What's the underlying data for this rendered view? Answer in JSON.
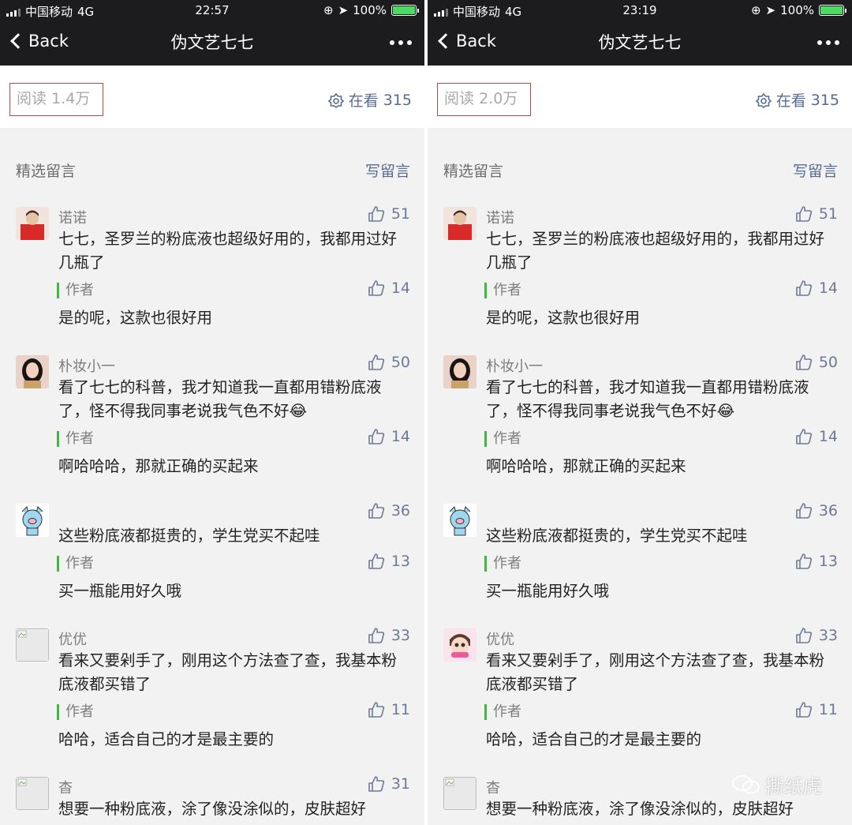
{
  "status_bar": {
    "carrier": "中国移动",
    "network": "4G",
    "battery": "100%"
  },
  "nav": {
    "back_label": "Back",
    "title": "伪文艺七七"
  },
  "section": {
    "title": "精选留言",
    "write_label": "写留言"
  },
  "stats_label_reads": "阅读",
  "stats_label_looking": "在看",
  "author_label": "作者",
  "panes": [
    {
      "time": "22:57",
      "reads": "1.4万",
      "looking": "315",
      "comments": [
        {
          "nickname": "诺诺",
          "likes": "51",
          "text": "七七，圣罗兰的粉底液也超级好用的，我都用过好几瓶了",
          "reply": "是的呢，这款也很好用",
          "reply_likes": "14",
          "avatar": "red-shirt"
        },
        {
          "nickname": "朴妆小一",
          "likes": "50",
          "text": "看了七七的科普，我才知道我一直都用错粉底液了，怪不得我同事老说我气色不好",
          "reply": "啊哈哈哈，那就正确的买起来",
          "reply_likes": "14",
          "avatar": "girl-photo"
        },
        {
          "nickname": "",
          "likes": "36",
          "text": "这些粉底液都挺贵的，学生党买不起哇",
          "reply": "买一瓶能用好久哦",
          "reply_likes": "13",
          "avatar": "pig-cartoon"
        },
        {
          "nickname": "优优",
          "likes": "33",
          "text": "看来又要剁手了，刚用这个方法查了查，我基本粉底液都买错了",
          "reply": "哈哈，适合自己的才是最主要的",
          "reply_likes": "11",
          "avatar": "broken-image"
        },
        {
          "nickname": "杳",
          "likes": "31",
          "text": "想要一种粉底液，涂了像没涂似的，皮肤超好",
          "avatar": "broken-image"
        }
      ]
    },
    {
      "time": "23:19",
      "reads": "2.0万",
      "looking": "315",
      "comments": [
        {
          "nickname": "诺诺",
          "likes": "51",
          "text": "七七，圣罗兰的粉底液也超级好用的，我都用过好几瓶了",
          "reply": "是的呢，这款也很好用",
          "reply_likes": "14",
          "avatar": "red-shirt"
        },
        {
          "nickname": "朴妆小一",
          "likes": "50",
          "text": "看了七七的科普，我才知道我一直都用错粉底液了，怪不得我同事老说我气色不好",
          "reply": "啊哈哈哈，那就正确的买起来",
          "reply_likes": "14",
          "avatar": "girl-photo"
        },
        {
          "nickname": "",
          "likes": "36",
          "text": "这些粉底液都挺贵的，学生党买不起哇",
          "reply": "买一瓶能用好久哦",
          "reply_likes": "13",
          "avatar": "pig-cartoon"
        },
        {
          "nickname": "优优",
          "likes": "33",
          "text": "看来又要剁手了，刚用这个方法查了查，我基本粉底液都买错了",
          "reply": "哈哈，适合自己的才是最主要的",
          "reply_likes": "11",
          "avatar": "girl-cartoon"
        },
        {
          "nickname": "杳",
          "likes": "",
          "text": "想要一种粉底液，涂了像没涂似的，皮肤超好",
          "avatar": "broken-image"
        }
      ]
    }
  ],
  "watermark": "撕纸虎",
  "colors": {
    "link": "#576b95",
    "highlight_box": "#c0454a",
    "author_bar": "#3fb83f",
    "navbar": "#1c1c1e"
  }
}
